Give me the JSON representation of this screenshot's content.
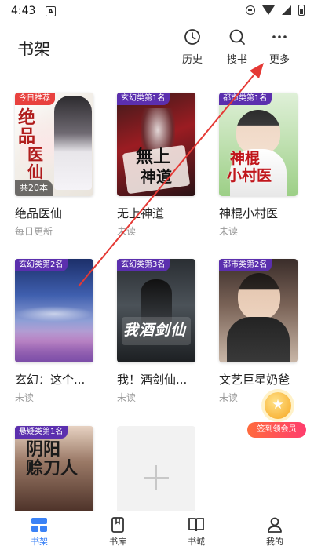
{
  "status_bar": {
    "time": "4:43",
    "app_icon": "A"
  },
  "header": {
    "title": "书架",
    "buttons": [
      {
        "label": "历史",
        "icon": "clock-icon"
      },
      {
        "label": "搜书",
        "icon": "search-icon"
      },
      {
        "label": "更多",
        "icon": "more-icon"
      }
    ]
  },
  "books": [
    {
      "tag": "今日推荐",
      "cover_text": "绝品医仙",
      "count": "共20本",
      "title": "绝品医仙",
      "subtitle": "每日更新"
    },
    {
      "tag": "玄幻类第1名",
      "cover_text": "无上神道",
      "title": "无上神道",
      "subtitle": "未读"
    },
    {
      "tag": "都市类第1名",
      "cover_text": "神棍小村医",
      "title": "神棍小村医",
      "subtitle": "未读"
    },
    {
      "tag": "玄幻类第2名",
      "title": "玄幻：这个...",
      "subtitle": "未读"
    },
    {
      "tag": "玄幻类第3名",
      "cover_text": "我酒剑仙",
      "title": "我！酒剑仙...",
      "subtitle": "未读"
    },
    {
      "tag": "都市类第2名",
      "title": "文艺巨星奶爸",
      "subtitle": "未读"
    },
    {
      "tag": "悬疑类第1名",
      "cover_text": "阴阳赊刀人"
    }
  ],
  "float_badge": {
    "label": "签到领会员"
  },
  "bottom_nav": [
    {
      "label": "书架",
      "icon": "bookshelf-icon",
      "active": true
    },
    {
      "label": "书库",
      "icon": "library-icon"
    },
    {
      "label": "书城",
      "icon": "bookstore-icon"
    },
    {
      "label": "我的",
      "icon": "profile-icon"
    }
  ],
  "colors": {
    "accent": "#3b82f6",
    "tag_purple": "#5b2fae",
    "tag_red": "#e8413e",
    "annotation": "#e53935"
  }
}
